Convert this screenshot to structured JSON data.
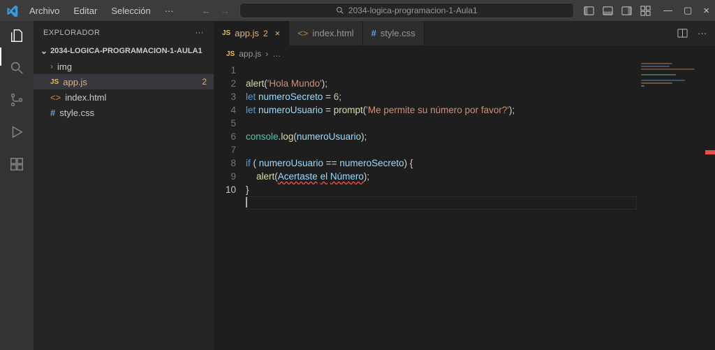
{
  "menu": {
    "archivo": "Archivo",
    "editar": "Editar",
    "seleccion": "Selección",
    "more": "···"
  },
  "search_center": "2034-logica-programacion-1-Aula1",
  "sidebar": {
    "title": "EXPLORADOR",
    "project": "2034-LOGICA-PROGRAMACION-1-AULA1",
    "items": [
      {
        "label": "img",
        "kind": "folder"
      },
      {
        "label": "app.js",
        "kind": "js",
        "problems": "2",
        "selected": true
      },
      {
        "label": "index.html",
        "kind": "html"
      },
      {
        "label": "style.css",
        "kind": "css"
      }
    ]
  },
  "tabs": [
    {
      "label": "app.js",
      "kind": "js",
      "problems": "2",
      "active": true,
      "close": "×"
    },
    {
      "label": "index.html",
      "kind": "html"
    },
    {
      "label": "style.css",
      "kind": "css"
    }
  ],
  "breadcrumb": {
    "file": "app.js",
    "sep": "›",
    "more": "…"
  },
  "code": {
    "l1": {
      "fn": "alert",
      "p": "(",
      "s": "'Hola Mundo'",
      "e": ");"
    },
    "l2": {
      "kw": "let",
      "var": "numeroSecreto",
      "eq": " = ",
      "num": "6",
      "e": ";"
    },
    "l3": {
      "kw": "let",
      "var": "numeroUsuario",
      "eq": " = ",
      "fn": "prompt",
      "p": "(",
      "s": "'Me permite su número por favor?'",
      "e": ");"
    },
    "l5": {
      "obj": "console",
      "dot": ".",
      "fn": "log",
      "p": "(",
      "var": "numeroUsuario",
      "e": ");"
    },
    "l7": {
      "kw": "if",
      "p1": " ( ",
      "v1": "numeroUsuario",
      "op": " == ",
      "v2": "numeroSecreto",
      "p2": ") {"
    },
    "l8": {
      "indent": "    ",
      "fn": "alert",
      "p": "(",
      "e1": "Acertaste",
      "sp": " ",
      "e2": "el",
      "sp2": " ",
      "e3": "Número",
      "e": ");"
    },
    "l9": {
      "brace": "}"
    }
  },
  "lineNumbers": [
    "1",
    "2",
    "3",
    "4",
    "5",
    "6",
    "7",
    "8",
    "9",
    "10"
  ]
}
